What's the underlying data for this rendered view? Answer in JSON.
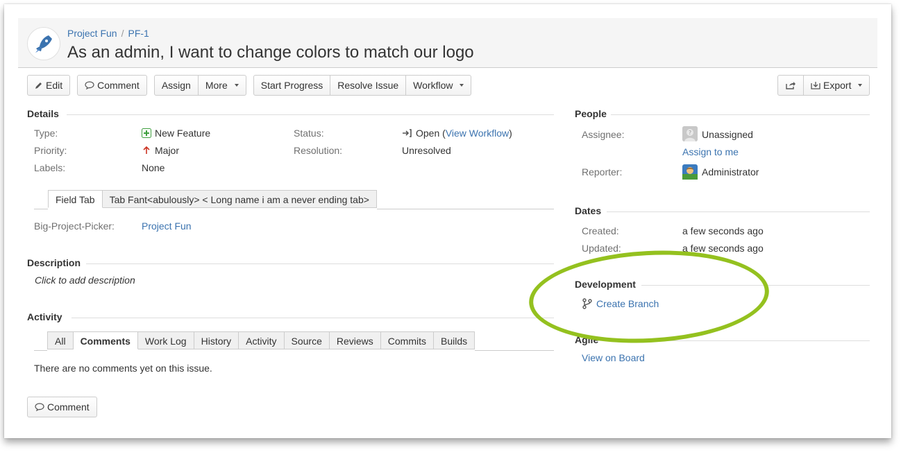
{
  "breadcrumb": {
    "project": "Project Fun",
    "separator": "/",
    "issue_key": "PF-1"
  },
  "issue": {
    "title": "As an admin, I want to change colors to match our logo"
  },
  "toolbar": {
    "edit": "Edit",
    "comment": "Comment",
    "assign": "Assign",
    "more": "More",
    "start_progress": "Start Progress",
    "resolve_issue": "Resolve Issue",
    "workflow": "Workflow",
    "export": "Export"
  },
  "details": {
    "heading": "Details",
    "type_label": "Type:",
    "type_value": "New Feature",
    "priority_label": "Priority:",
    "priority_value": "Major",
    "labels_label": "Labels:",
    "labels_value": "None",
    "status_label": "Status:",
    "status_value": "Open",
    "status_open_paren": "(",
    "view_workflow": "View Workflow",
    "status_close_paren": ")",
    "resolution_label": "Resolution:",
    "resolution_value": "Unresolved"
  },
  "field_tabs": [
    "Field Tab",
    "Tab Fant<abulously> < Long name i am a never ending tab>"
  ],
  "custom_field": {
    "label": "Big-Project-Picker:",
    "value": "Project Fun"
  },
  "description": {
    "heading": "Description",
    "placeholder": "Click to add description"
  },
  "activity": {
    "heading": "Activity",
    "tabs": [
      "All",
      "Comments",
      "Work Log",
      "History",
      "Activity",
      "Source",
      "Reviews",
      "Commits",
      "Builds"
    ],
    "empty": "There are no comments yet on this issue.",
    "comment_button": "Comment"
  },
  "people": {
    "heading": "People",
    "assignee_label": "Assignee:",
    "assignee_value": "Unassigned",
    "assign_to_me": "Assign to me",
    "reporter_label": "Reporter:",
    "reporter_value": "Administrator"
  },
  "dates": {
    "heading": "Dates",
    "created_label": "Created:",
    "created_value": "a few seconds ago",
    "updated_label": "Updated:",
    "updated_value": "a few seconds ago"
  },
  "development": {
    "heading": "Development",
    "create_branch": "Create Branch"
  },
  "agile": {
    "heading": "Agile",
    "view_on_board": "View on Board"
  },
  "colors": {
    "link": "#3b73af",
    "highlight": "#94c11f"
  }
}
